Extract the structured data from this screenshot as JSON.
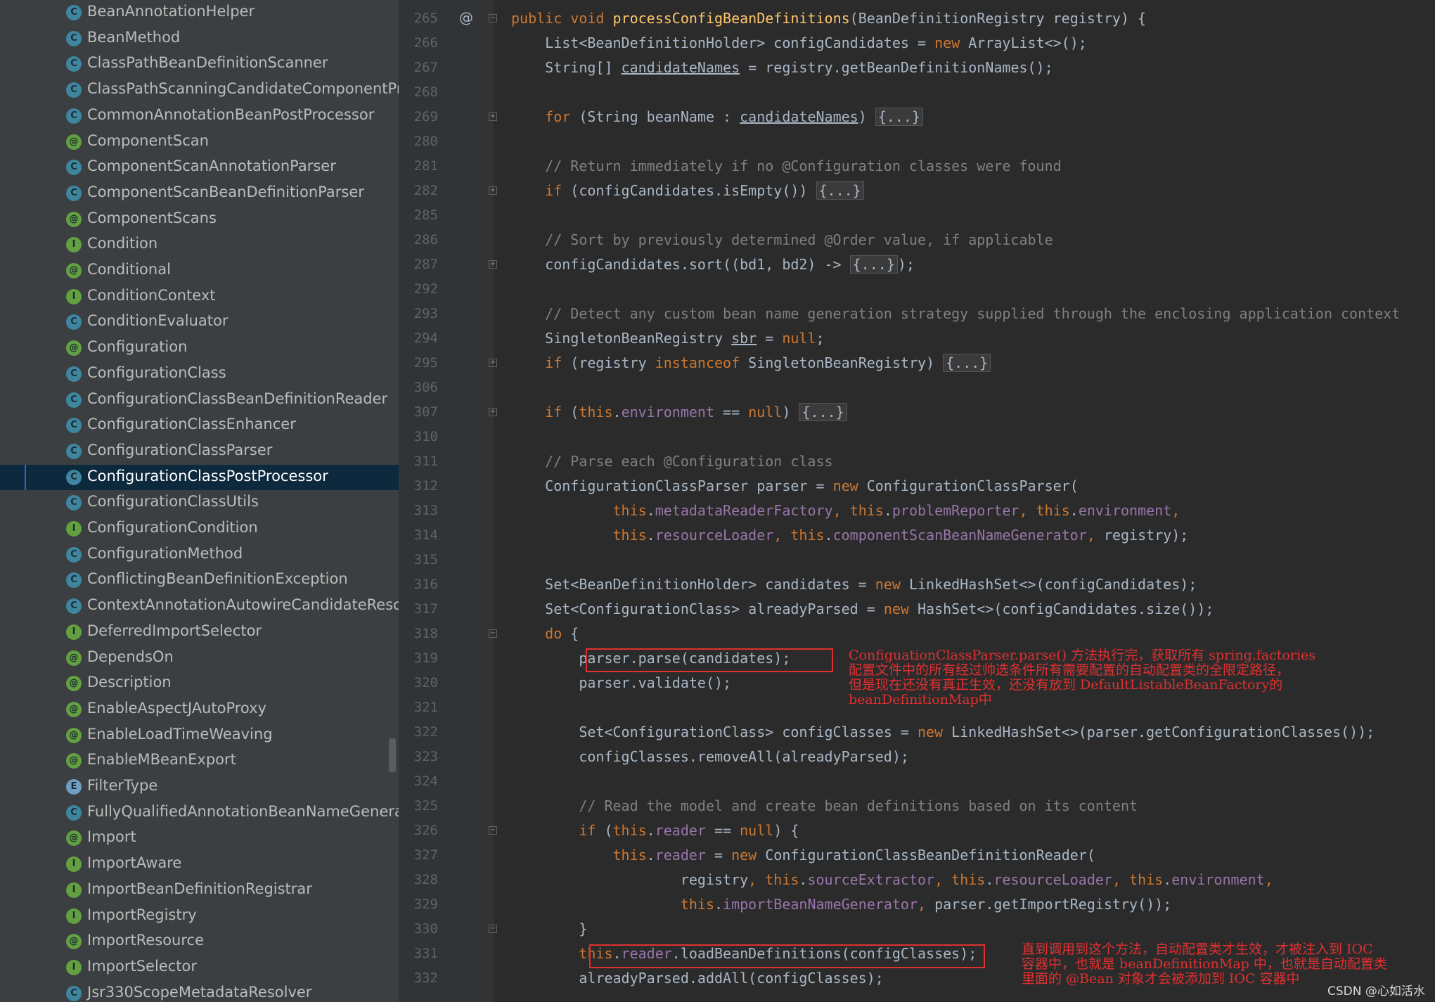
{
  "sidebar": {
    "items": [
      {
        "label": "BeanAnnotationHelper",
        "icon": "c",
        "icon_name": "class-icon"
      },
      {
        "label": "BeanMethod",
        "icon": "c",
        "icon_name": "class-icon"
      },
      {
        "label": "ClassPathBeanDefinitionScanner",
        "icon": "c",
        "icon_name": "class-icon"
      },
      {
        "label": "ClassPathScanningCandidateComponentProvider",
        "icon": "c",
        "icon_name": "class-icon"
      },
      {
        "label": "CommonAnnotationBeanPostProcessor",
        "icon": "c",
        "icon_name": "class-icon"
      },
      {
        "label": "ComponentScan",
        "icon": "a",
        "icon_name": "annotation-icon"
      },
      {
        "label": "ComponentScanAnnotationParser",
        "icon": "c",
        "icon_name": "class-icon"
      },
      {
        "label": "ComponentScanBeanDefinitionParser",
        "icon": "c",
        "icon_name": "class-icon"
      },
      {
        "label": "ComponentScans",
        "icon": "a",
        "icon_name": "annotation-icon"
      },
      {
        "label": "Condition",
        "icon": "i",
        "icon_name": "interface-icon"
      },
      {
        "label": "Conditional",
        "icon": "a",
        "icon_name": "annotation-icon"
      },
      {
        "label": "ConditionContext",
        "icon": "i",
        "icon_name": "interface-icon"
      },
      {
        "label": "ConditionEvaluator",
        "icon": "c",
        "icon_name": "class-icon"
      },
      {
        "label": "Configuration",
        "icon": "a",
        "icon_name": "annotation-icon"
      },
      {
        "label": "ConfigurationClass",
        "icon": "c",
        "icon_name": "class-icon"
      },
      {
        "label": "ConfigurationClassBeanDefinitionReader",
        "icon": "c",
        "icon_name": "class-icon"
      },
      {
        "label": "ConfigurationClassEnhancer",
        "icon": "c",
        "icon_name": "class-icon"
      },
      {
        "label": "ConfigurationClassParser",
        "icon": "c",
        "icon_name": "class-icon"
      },
      {
        "label": "ConfigurationClassPostProcessor",
        "icon": "c",
        "icon_name": "class-icon",
        "selected": true
      },
      {
        "label": "ConfigurationClassUtils",
        "icon": "abs",
        "icon_name": "abstract-class-icon"
      },
      {
        "label": "ConfigurationCondition",
        "icon": "i",
        "icon_name": "interface-icon"
      },
      {
        "label": "ConfigurationMethod",
        "icon": "abs",
        "icon_name": "abstract-class-icon"
      },
      {
        "label": "ConflictingBeanDefinitionException",
        "icon": "c",
        "icon_name": "class-icon"
      },
      {
        "label": "ContextAnnotationAutowireCandidateResolver",
        "icon": "c",
        "icon_name": "class-icon"
      },
      {
        "label": "DeferredImportSelector",
        "icon": "i",
        "icon_name": "interface-icon"
      },
      {
        "label": "DependsOn",
        "icon": "a",
        "icon_name": "annotation-icon"
      },
      {
        "label": "Description",
        "icon": "a",
        "icon_name": "annotation-icon"
      },
      {
        "label": "EnableAspectJAutoProxy",
        "icon": "a",
        "icon_name": "annotation-icon"
      },
      {
        "label": "EnableLoadTimeWeaving",
        "icon": "a",
        "icon_name": "annotation-icon"
      },
      {
        "label": "EnableMBeanExport",
        "icon": "a",
        "icon_name": "annotation-icon"
      },
      {
        "label": "FilterType",
        "icon": "e",
        "icon_name": "enum-icon"
      },
      {
        "label": "FullyQualifiedAnnotationBeanNameGenerator",
        "icon": "c",
        "icon_name": "class-icon"
      },
      {
        "label": "Import",
        "icon": "a",
        "icon_name": "annotation-icon"
      },
      {
        "label": "ImportAware",
        "icon": "i",
        "icon_name": "interface-icon"
      },
      {
        "label": "ImportBeanDefinitionRegistrar",
        "icon": "i",
        "icon_name": "interface-icon"
      },
      {
        "label": "ImportRegistry",
        "icon": "i",
        "icon_name": "interface-icon"
      },
      {
        "label": "ImportResource",
        "icon": "a",
        "icon_name": "annotation-icon"
      },
      {
        "label": "ImportSelector",
        "icon": "i",
        "icon_name": "interface-icon"
      },
      {
        "label": "Jsr330ScopeMetadataResolver",
        "icon": "c",
        "icon_name": "class-icon"
      }
    ]
  },
  "editor": {
    "lines": [
      {
        "ln": "265",
        "marker": "@",
        "fold": "−",
        "tokens": [
          [
            "",
            "public void "
          ],
          [
            "fn",
            "processConfigBeanDefinitions"
          ],
          [
            "",
            "(BeanDefinitionRegistry registry) {"
          ]
        ],
        "kwmap": {
          "public void ": "kw"
        }
      },
      {
        "ln": "266",
        "tokens": [
          [
            "",
            "    List<BeanDefinitionHolder> configCandidates = "
          ],
          [
            "kw",
            "new "
          ],
          [
            "",
            "ArrayList<>();"
          ]
        ]
      },
      {
        "ln": "267",
        "tokens": [
          [
            "",
            "    String[] "
          ],
          [
            "ul",
            "candidateNames"
          ],
          [
            "",
            " = registry.getBeanDefinitionNames();"
          ]
        ]
      },
      {
        "ln": "268",
        "tokens": []
      },
      {
        "ln": "269",
        "fold": "+",
        "tokens": [
          [
            "",
            "    "
          ],
          [
            "kw",
            "for "
          ],
          [
            "",
            "(String beanName : "
          ],
          [
            "ul",
            "candidateNames"
          ],
          [
            "",
            ") "
          ],
          [
            "folded",
            "{...}"
          ]
        ]
      },
      {
        "ln": "280",
        "tokens": []
      },
      {
        "ln": "281",
        "tokens": [
          [
            "cm",
            "    // Return immediately if no @Configuration classes were found"
          ]
        ]
      },
      {
        "ln": "282",
        "fold": "+",
        "tokens": [
          [
            "",
            "    "
          ],
          [
            "kw",
            "if "
          ],
          [
            "",
            "(configCandidates.isEmpty()) "
          ],
          [
            "folded",
            "{...}"
          ]
        ]
      },
      {
        "ln": "285",
        "tokens": []
      },
      {
        "ln": "286",
        "tokens": [
          [
            "cm",
            "    // Sort by previously determined @Order value, if applicable"
          ]
        ]
      },
      {
        "ln": "287",
        "fold": "+",
        "tokens": [
          [
            "",
            "    configCandidates.sort((bd1, bd2) -> "
          ],
          [
            "folded",
            "{...}"
          ],
          [
            "",
            ");"
          ]
        ]
      },
      {
        "ln": "292",
        "tokens": []
      },
      {
        "ln": "293",
        "tokens": [
          [
            "cm",
            "    // Detect any custom bean name generation strategy supplied through the enclosing application context"
          ]
        ]
      },
      {
        "ln": "294",
        "tokens": [
          [
            "",
            "    SingletonBeanRegistry "
          ],
          [
            "ul",
            "sbr"
          ],
          [
            "",
            " = "
          ],
          [
            "kw",
            "null"
          ],
          [
            "",
            ";"
          ]
        ]
      },
      {
        "ln": "295",
        "fold": "+",
        "tokens": [
          [
            "",
            "    "
          ],
          [
            "kw",
            "if "
          ],
          [
            "",
            "(registry "
          ],
          [
            "kw",
            "instanceof "
          ],
          [
            "",
            "SingletonBeanRegistry) "
          ],
          [
            "folded",
            "{...}"
          ]
        ]
      },
      {
        "ln": "306",
        "tokens": []
      },
      {
        "ln": "307",
        "fold": "+",
        "tokens": [
          [
            "",
            "    "
          ],
          [
            "kw",
            "if "
          ],
          [
            "",
            "("
          ],
          [
            "kw",
            "this"
          ],
          [
            "",
            "."
          ],
          [
            "fld",
            "environment"
          ],
          [
            "",
            " == "
          ],
          [
            "kw",
            "null"
          ],
          [
            "",
            ") "
          ],
          [
            "folded",
            "{...}"
          ]
        ]
      },
      {
        "ln": "310",
        "tokens": []
      },
      {
        "ln": "311",
        "tokens": [
          [
            "cm",
            "    // Parse each @Configuration class"
          ]
        ]
      },
      {
        "ln": "312",
        "tokens": [
          [
            "",
            "    ConfigurationClassParser parser = "
          ],
          [
            "kw",
            "new "
          ],
          [
            "",
            "ConfigurationClassParser("
          ]
        ]
      },
      {
        "ln": "313",
        "tokens": [
          [
            "",
            "            "
          ],
          [
            "kw",
            "this"
          ],
          [
            "",
            "."
          ],
          [
            "fld",
            "metadataReaderFactory"
          ],
          [
            "kw",
            ", this"
          ],
          [
            "",
            "."
          ],
          [
            "fld",
            "problemReporter"
          ],
          [
            "kw",
            ", this"
          ],
          [
            "",
            "."
          ],
          [
            "fld",
            "environment"
          ],
          [
            "kw",
            ","
          ]
        ]
      },
      {
        "ln": "314",
        "tokens": [
          [
            "",
            "            "
          ],
          [
            "kw",
            "this"
          ],
          [
            "",
            "."
          ],
          [
            "fld",
            "resourceLoader"
          ],
          [
            "kw",
            ", this"
          ],
          [
            "",
            "."
          ],
          [
            "fld",
            "componentScanBeanNameGenerator"
          ],
          [
            "kw",
            ", "
          ],
          [
            "",
            "registry);"
          ]
        ]
      },
      {
        "ln": "315",
        "tokens": []
      },
      {
        "ln": "316",
        "tokens": [
          [
            "",
            "    Set<BeanDefinitionHolder> candidates = "
          ],
          [
            "kw",
            "new "
          ],
          [
            "",
            "LinkedHashSet<>(configCandidates);"
          ]
        ]
      },
      {
        "ln": "317",
        "tokens": [
          [
            "",
            "    Set<ConfigurationClass> alreadyParsed = "
          ],
          [
            "kw",
            "new "
          ],
          [
            "",
            "HashSet<>(configCandidates.size());"
          ]
        ]
      },
      {
        "ln": "318",
        "fold": "−",
        "tokens": [
          [
            "",
            "    "
          ],
          [
            "kw",
            "do "
          ],
          [
            "",
            "{"
          ]
        ]
      },
      {
        "ln": "319",
        "tokens": [
          [
            "",
            "        parser.parse(candidates);"
          ]
        ]
      },
      {
        "ln": "320",
        "tokens": [
          [
            "",
            "        parser.validate();"
          ]
        ]
      },
      {
        "ln": "321",
        "tokens": []
      },
      {
        "ln": "322",
        "tokens": [
          [
            "",
            "        Set<ConfigurationClass> configClasses = "
          ],
          [
            "kw",
            "new "
          ],
          [
            "",
            "LinkedHashSet<>(parser.getConfigurationClasses());"
          ]
        ]
      },
      {
        "ln": "323",
        "tokens": [
          [
            "",
            "        configClasses.removeAll(alreadyParsed);"
          ]
        ]
      },
      {
        "ln": "324",
        "tokens": []
      },
      {
        "ln": "325",
        "tokens": [
          [
            "cm",
            "        // Read the model and create bean definitions based on its content"
          ]
        ]
      },
      {
        "ln": "326",
        "fold": "−",
        "tokens": [
          [
            "",
            "        "
          ],
          [
            "kw",
            "if "
          ],
          [
            "",
            "("
          ],
          [
            "kw",
            "this"
          ],
          [
            "",
            "."
          ],
          [
            "fld",
            "reader"
          ],
          [
            "",
            " == "
          ],
          [
            "kw",
            "null"
          ],
          [
            "",
            ") {"
          ]
        ]
      },
      {
        "ln": "327",
        "tokens": [
          [
            "",
            "            "
          ],
          [
            "kw",
            "this"
          ],
          [
            "",
            "."
          ],
          [
            "fld",
            "reader"
          ],
          [
            "",
            " = "
          ],
          [
            "kw",
            "new "
          ],
          [
            "",
            "ConfigurationClassBeanDefinitionReader("
          ]
        ]
      },
      {
        "ln": "328",
        "tokens": [
          [
            "",
            "                    registry"
          ],
          [
            "kw",
            ", this"
          ],
          [
            "",
            "."
          ],
          [
            "fld",
            "sourceExtractor"
          ],
          [
            "kw",
            ", this"
          ],
          [
            "",
            "."
          ],
          [
            "fld",
            "resourceLoader"
          ],
          [
            "kw",
            ", this"
          ],
          [
            "",
            "."
          ],
          [
            "fld",
            "environment"
          ],
          [
            "kw",
            ","
          ]
        ]
      },
      {
        "ln": "329",
        "tokens": [
          [
            "",
            "                    "
          ],
          [
            "kw",
            "this"
          ],
          [
            "",
            "."
          ],
          [
            "fld",
            "importBeanNameGenerator"
          ],
          [
            "kw",
            ", "
          ],
          [
            "",
            "parser.getImportRegistry());"
          ]
        ]
      },
      {
        "ln": "330",
        "fold": "−",
        "tokens": [
          [
            "",
            "        }"
          ]
        ]
      },
      {
        "ln": "331",
        "tokens": [
          [
            "",
            "        "
          ],
          [
            "kw",
            "this"
          ],
          [
            "",
            "."
          ],
          [
            "fld",
            "reader"
          ],
          [
            "",
            ".loadBeanDefinitions(configClasses);"
          ]
        ]
      },
      {
        "ln": "332",
        "tokens": [
          [
            "",
            "        alreadyParsed.addAll(configClasses);"
          ]
        ]
      }
    ]
  },
  "annotations": {
    "note1": [
      "ConfiguationClassParser.parse() 方法执行完，获取所有 spring.factories",
      "配置文件中的所有经过帅选条件所有需要配置的自动配置类的全限定路径，",
      "但是现在还没有真正生效，还没有放到 DefaultListableBeanFactory的",
      "beanDefinitionMap中"
    ],
    "note2": [
      "直到调用到这个方法，自动配置类才生效，才被注入到 IOC",
      "容器中，也就是 beanDefinitionMap 中，也就是自动配置类",
      "里面的 @Bean 对象才会被添加到 IOC 容器中"
    ]
  },
  "watermark": "CSDN @心如活水",
  "colors": {
    "selection": "#0d293e",
    "annotation_red": "#e03030",
    "keyword": "#cc7832",
    "method": "#ffc66d",
    "field": "#9876aa",
    "comment": "#808080"
  }
}
